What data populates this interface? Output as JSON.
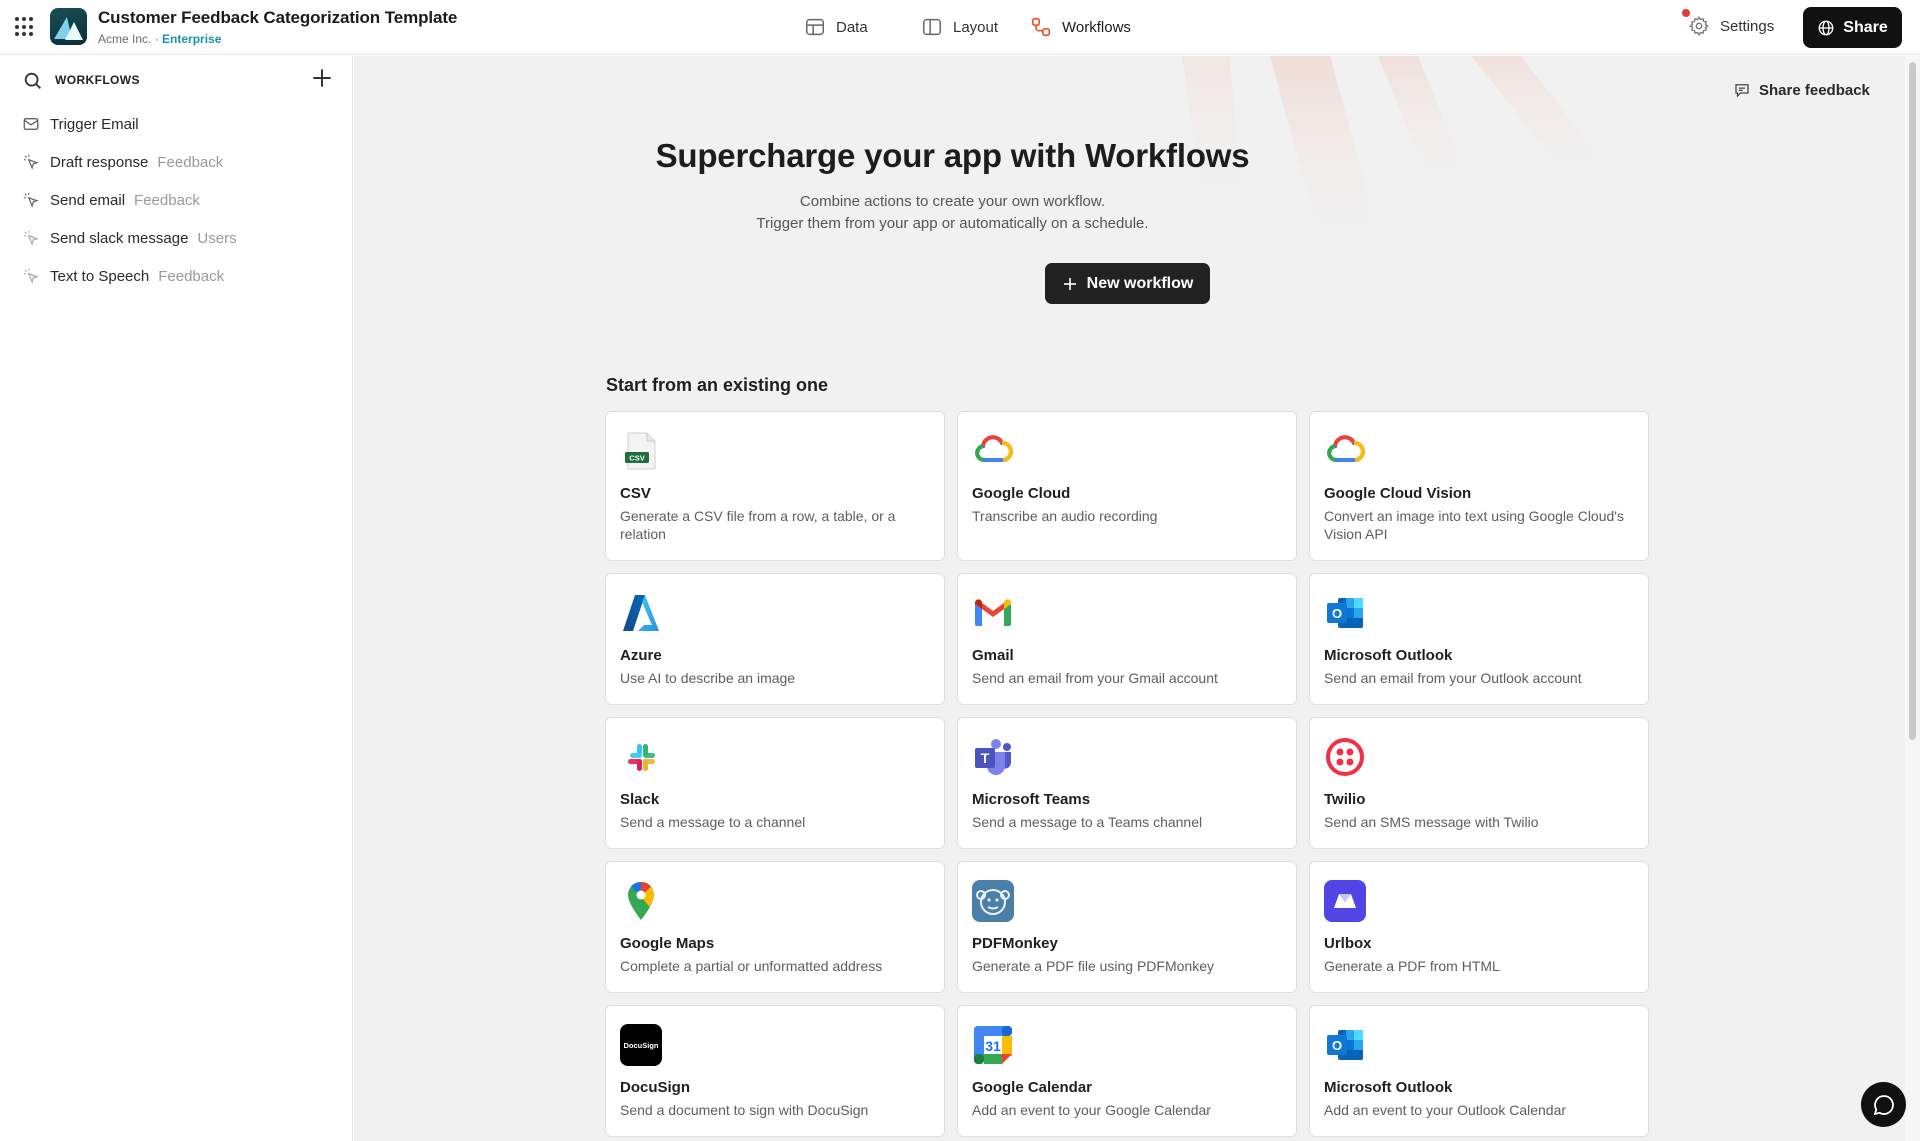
{
  "app": {
    "title": "Customer Feedback Categorization Template",
    "org": "Acme Inc.",
    "separator": "·",
    "plan": "Enterprise"
  },
  "topnav": {
    "data": "Data",
    "layout": "Layout",
    "workflows": "Workflows",
    "settings": "Settings",
    "share": "Share"
  },
  "sidebar": {
    "heading": "WORKFLOWS",
    "items": [
      {
        "label": "Trigger Email",
        "tag": "",
        "icon": "mail-icon"
      },
      {
        "label": "Draft response",
        "tag": "Feedback",
        "icon": "workflow-icon"
      },
      {
        "label": "Send email",
        "tag": "Feedback",
        "icon": "workflow-icon"
      },
      {
        "label": "Send slack message",
        "tag": "Users",
        "icon": "workflow-icon"
      },
      {
        "label": "Text to Speech",
        "tag": "Feedback",
        "icon": "workflow-icon"
      }
    ]
  },
  "main": {
    "share_feedback": "Share feedback",
    "hero_title": "Supercharge your app with Workflows",
    "hero_line1": "Combine actions to create your own workflow.",
    "hero_line2": "Trigger them from your app or automatically on a schedule.",
    "new_workflow": "New workflow",
    "section_title": "Start from an existing one",
    "cards": [
      {
        "title": "CSV",
        "desc": "Generate a CSV file from a row, a table, or a relation",
        "icon": "csv-file-icon"
      },
      {
        "title": "Google Cloud",
        "desc": "Transcribe an audio recording",
        "icon": "google-cloud-icon"
      },
      {
        "title": "Google Cloud Vision",
        "desc": "Convert an image into text using Google Cloud's Vision API",
        "icon": "google-cloud-vision-icon"
      },
      {
        "title": "Azure",
        "desc": "Use AI to describe an image",
        "icon": "azure-icon"
      },
      {
        "title": "Gmail",
        "desc": "Send an email from your Gmail account",
        "icon": "gmail-icon"
      },
      {
        "title": "Microsoft Outlook",
        "desc": "Send an email from your Outlook account",
        "icon": "outlook-icon"
      },
      {
        "title": "Slack",
        "desc": "Send a message to a channel",
        "icon": "slack-icon"
      },
      {
        "title": "Microsoft Teams",
        "desc": "Send a message to a Teams channel",
        "icon": "teams-icon"
      },
      {
        "title": "Twilio",
        "desc": "Send an SMS message with Twilio",
        "icon": "twilio-icon"
      },
      {
        "title": "Google Maps",
        "desc": "Complete a partial or unformatted address",
        "icon": "google-maps-icon"
      },
      {
        "title": "PDFMonkey",
        "desc": "Generate a PDF file using PDFMonkey",
        "icon": "pdfmonkey-icon"
      },
      {
        "title": "Urlbox",
        "desc": "Generate a PDF from HTML",
        "icon": "urlbox-icon"
      },
      {
        "title": "DocuSign",
        "desc": "Send a document to sign with DocuSign",
        "icon": "docusign-icon"
      },
      {
        "title": "Google Calendar",
        "desc": "Add an event to your Google Calendar",
        "icon": "google-calendar-icon"
      },
      {
        "title": "Microsoft Outlook",
        "desc": "Add an event to your Outlook Calendar",
        "icon": "outlook-icon"
      }
    ],
    "logo_text": {
      "csv": "CSV",
      "docusign": "DocuSign",
      "calendar": "31",
      "outlook": "O",
      "teams": "T"
    }
  },
  "colors": {
    "accent_dark": "#111111",
    "enterprise": "#1a93b0",
    "workflows_icon": "#e8552f",
    "notification_dot": "#e5383b"
  }
}
